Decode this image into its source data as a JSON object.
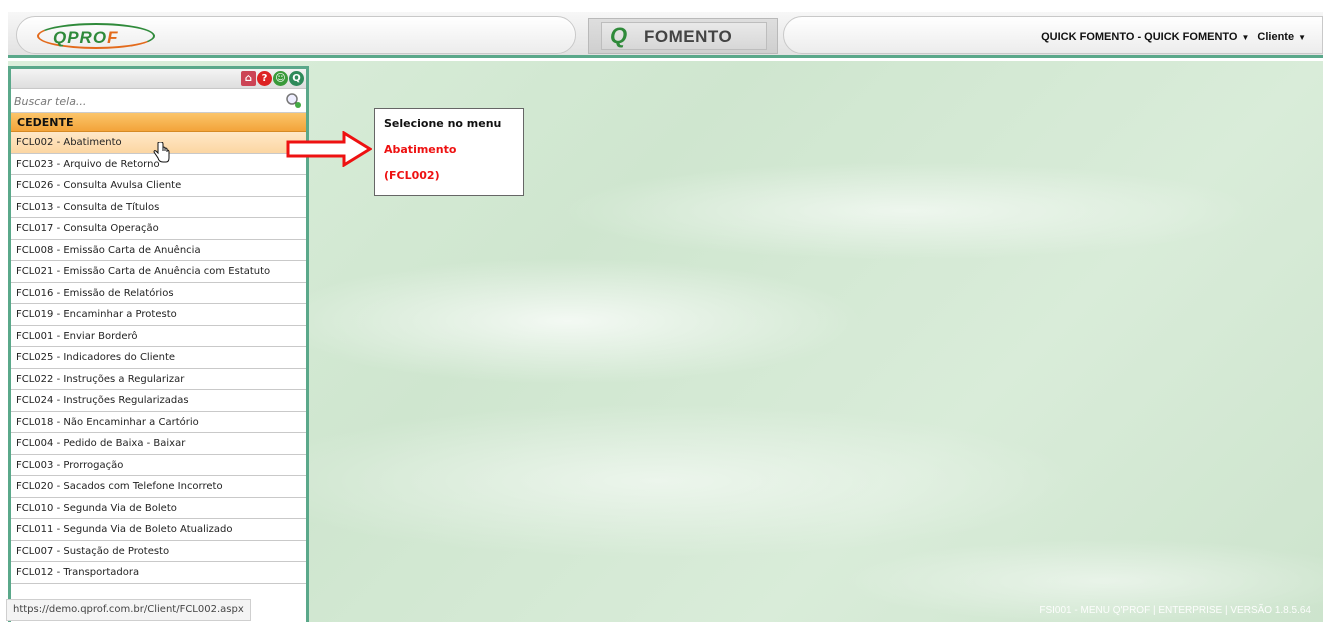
{
  "header": {
    "logo_text_a": "QPRO",
    "logo_text_b": "F",
    "module_glyph": "Q",
    "module_name": "FOMENTO",
    "company": "QUICK FOMENTO - QUICK FOMENTO",
    "role": "Cliente"
  },
  "sidebar": {
    "toolbar_icons": [
      "home-icon",
      "help-icon",
      "users-icon",
      "logout-icon"
    ],
    "search_placeholder": "Buscar tela...",
    "section": "CEDENTE",
    "items": [
      "FCL002 - Abatimento",
      "FCL023 - Arquivo de Retorno",
      "FCL026 - Consulta Avulsa Cliente",
      "FCL013 - Consulta de Títulos",
      "FCL017 - Consulta Operação",
      "FCL008 - Emissão Carta de Anuência",
      "FCL021 - Emissão Carta de Anuência com Estatuto",
      "FCL016 - Emissão de Relatórios",
      "FCL019 - Encaminhar a Protesto",
      "FCL001 - Enviar Borderô",
      "FCL025 - Indicadores do Cliente",
      "FCL022 - Instruções a Regularizar",
      "FCL024 - Instruções Regularizadas",
      "FCL018 - Não Encaminhar a Cartório",
      "FCL004 - Pedido de Baixa - Baixar",
      "FCL003 - Prorrogação",
      "FCL020 - Sacados com Telefone Incorreto",
      "FCL010 - Segunda Via de Boleto",
      "FCL011 - Segunda Via de Boleto Atualizado",
      "FCL007 - Sustação de Protesto",
      "FCL012 - Transportadora"
    ],
    "active_index": 0
  },
  "callout": {
    "line1": "Selecione no menu",
    "line2": "Abatimento",
    "line3": "(FCL002)"
  },
  "status_url": "https://demo.qprof.com.br/Client/FCL002.aspx",
  "footer": "FSI001 - MENU Q'PROF | ENTERPRISE | VERSÃO 1.8.5.64",
  "colors": {
    "accent_green": "#5aa88a",
    "section_orange": "#f3a43a",
    "callout_red": "#ee1111"
  }
}
